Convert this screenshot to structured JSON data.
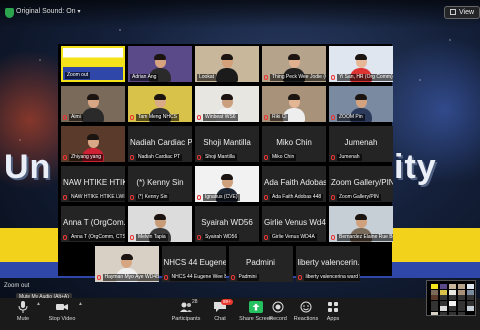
{
  "top_bar": {
    "original_sound": "Original Sound: On",
    "view_label": "View"
  },
  "gallery": {
    "rows": [
      [
        {
          "label": "Zoom out",
          "pname": "",
          "photo": "slide",
          "active": true,
          "muted": false
        },
        {
          "label": "Adrian Ang",
          "pname": "",
          "photo": "person",
          "skin": "#d6a37e",
          "shirt": "#2a2a2a",
          "bgc": "#5a4a8a"
        },
        {
          "label": "Lookat",
          "pname": "",
          "photo": "person",
          "skin": "#d4a07a",
          "shirt": "#1b1b1b",
          "bgc": "#c9b79b"
        },
        {
          "label": "Thing Peck Wee Jodie (OrgComm)",
          "pname": "",
          "photo": "person",
          "skin": "#e0b08f",
          "shirt": "#222",
          "bgc": "#b5a38c",
          "muted": true
        },
        {
          "label": "Yi San, HR (Org Comm)",
          "pname": "",
          "photo": "person",
          "skin": "#e6b898",
          "shirt": "#d33",
          "bgc": "#e0e6f0",
          "muted": true
        }
      ],
      [
        {
          "label": "Aimi",
          "pname": "",
          "photo": "person",
          "skin": "#d8a684",
          "shirt": "#2a2a2a",
          "bgc": "#7a6a5a",
          "muted": true
        },
        {
          "label": "Tam Meng NHCS",
          "pname": "",
          "photo": "person",
          "skin": "#d9aa85",
          "shirt": "#333",
          "bgc": "#d8c24a",
          "muted": true
        },
        {
          "label": "Winbeat WS6",
          "pname": "",
          "photo": "person",
          "skin": "#caa07e",
          "shirt": "#f0f0f0",
          "bgc": "#e8e6e0",
          "muted": true
        },
        {
          "label": "Riki Cl",
          "pname": "",
          "photo": "person",
          "skin": "#e2b594",
          "shirt": "#eee",
          "bgc": "#a9927a",
          "muted": true
        },
        {
          "label": "ZOOM Pin",
          "pname": "",
          "photo": "person",
          "skin": "#d3a27f",
          "shirt": "#2b3a5a",
          "bgc": "#7a8aa0",
          "muted": true
        }
      ],
      [
        {
          "label": "Zhiyang yang",
          "pname": "",
          "photo": "person",
          "skin": "#d9a987",
          "shirt": "#c23",
          "bgc": "#5a3a2a",
          "muted": true
        },
        {
          "label": "Nadiah Cardiac PT",
          "pname": "Nadiah Cardiac PT",
          "photo": "none",
          "muted": true
        },
        {
          "label": "Shoji Mantilla",
          "pname": "Shoji Mantilla",
          "photo": "none",
          "muted": true
        },
        {
          "label": "Miko Chin",
          "pname": "Miko Chin",
          "photo": "none",
          "muted": true
        },
        {
          "label": "Jumenah",
          "pname": "Jumenah",
          "photo": "none",
          "muted": true
        }
      ],
      [
        {
          "label": "NAW HTIKE HTIKE LWIN(CT...",
          "pname": "NAW HTIKE HTIK...",
          "photo": "none",
          "muted": true
        },
        {
          "label": "(*) Kenny Sin",
          "pname": "(*) Kenny Sin",
          "photo": "none",
          "muted": true
        },
        {
          "label": "Ignatius (CVE)",
          "pname": "",
          "photo": "person",
          "skin": "#cfa07c",
          "shirt": "#1c2430",
          "bgc": "#f2f2f2",
          "muted": true
        },
        {
          "label": "Ada Faith Adobas 448",
          "pname": "Ada Faith Adobas...",
          "photo": "none",
          "muted": true
        },
        {
          "label": "Zoom Gallery/PIN",
          "pname": "Zoom Gallery/PIN",
          "photo": "none",
          "muted": true
        }
      ],
      [
        {
          "label": "Anna T (OrgComm, CTS)",
          "pname": "Anna T (OrgCom...",
          "photo": "none",
          "muted": true
        },
        {
          "label": "Melvin Tapia",
          "pname": "",
          "photo": "person",
          "skin": "#c99c78",
          "shirt": "#3a3a3a",
          "bgc": "#dcdcdc",
          "muted": true
        },
        {
          "label": "Syairah WD56",
          "pname": "Syairah WD56",
          "photo": "none",
          "muted": true
        },
        {
          "label": "Girlie Venus WD4A",
          "pname": "Girlie Venus Wd4...",
          "photo": "none",
          "muted": true
        },
        {
          "label": "Bernardez Elaine Rue Bernard...",
          "pname": "",
          "photo": "person",
          "skin": "#d0a17d",
          "shirt": "#7a6a5a",
          "bgc": "#c7cfd6",
          "muted": true
        }
      ],
      [
        {
          "label": "Hayman Myo Aye WD4B",
          "pname": "",
          "photo": "person",
          "skin": "#d6a682",
          "shirt": "#eee",
          "bgc": "#d8d0c4",
          "muted": true
        },
        {
          "label": "NHCS 44 Eugene Wee Ben...",
          "pname": "NHCS 44 Eugene...",
          "photo": "none",
          "muted": true
        },
        {
          "label": "Padmini",
          "pname": "Padmini",
          "photo": "none",
          "muted": true
        },
        {
          "label": "liberty valencerina ward 56",
          "pname": "liberty valencerin...",
          "photo": "none",
          "muted": true
        }
      ]
    ]
  },
  "background": {
    "word_left": "Un",
    "word_right": "ity"
  },
  "zoom_out_hint": "Zoom out",
  "toolbar": {
    "mute_tooltip": "Mute My Audio (Alt+A)",
    "mute": "Mute",
    "stop_video": "Stop Video",
    "participants": "Participants",
    "participants_count": "28",
    "chat": "Chat",
    "chat_badge": "99+",
    "share_screen": "Share Screen",
    "record": "Record",
    "reactions": "Reactions",
    "apps": "Apps"
  },
  "colors": {
    "active_speaker": "#f4e21a",
    "share_green": "#25c060",
    "chat_badge_red": "#e8382e",
    "tile_bg": "#242424"
  }
}
